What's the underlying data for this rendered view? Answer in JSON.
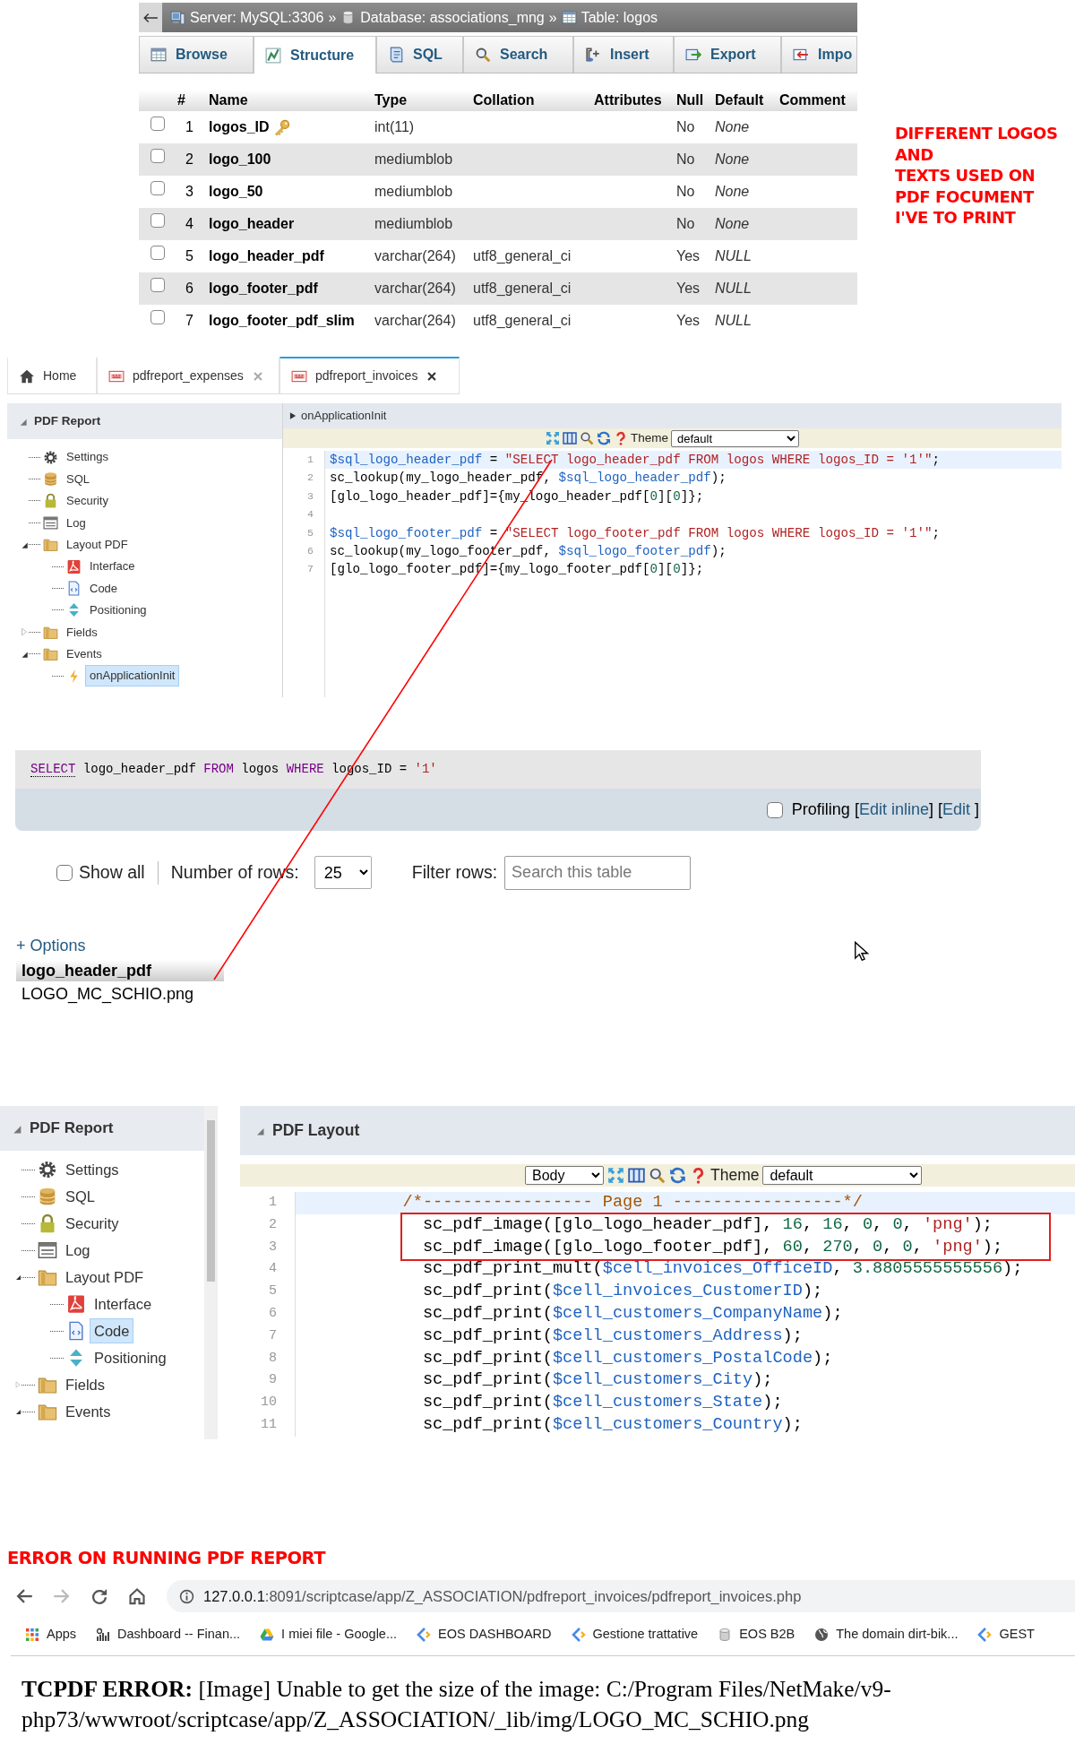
{
  "phpmyadmin": {
    "breadcrumb": [
      {
        "label": "Server: MySQL:3306",
        "kind": "server"
      },
      {
        "label": "Database: associations_mng",
        "kind": "database"
      },
      {
        "label": "Table: logos",
        "kind": "table"
      }
    ],
    "separator": "»",
    "tabs": [
      {
        "label": "Browse",
        "kind": "browse",
        "selected": false
      },
      {
        "label": "Structure",
        "kind": "structure",
        "selected": true
      },
      {
        "label": "SQL",
        "kind": "sql",
        "selected": false
      },
      {
        "label": "Search",
        "kind": "search",
        "selected": false
      },
      {
        "label": "Insert",
        "kind": "insert",
        "selected": false
      },
      {
        "label": "Export",
        "kind": "export",
        "selected": false
      },
      {
        "label": "Impo",
        "kind": "import",
        "selected": false
      }
    ],
    "columns": [
      "#",
      "Name",
      "Type",
      "Collation",
      "Attributes",
      "Null",
      "Default",
      "Comment"
    ],
    "rows": [
      {
        "checked": false,
        "number": "1",
        "name": "logos_ID",
        "primary_key": true,
        "type": "int(11)",
        "null": "No",
        "default": "None"
      },
      {
        "checked": false,
        "number": "2",
        "name": "logo_100",
        "primary_key": false,
        "type": "mediumblob",
        "null": "No",
        "default": "None"
      },
      {
        "checked": false,
        "number": "3",
        "name": "logo_50",
        "primary_key": false,
        "type": "mediumblob",
        "null": "No",
        "default": "None"
      },
      {
        "checked": false,
        "number": "4",
        "name": "logo_header",
        "primary_key": false,
        "type": "mediumblob",
        "null": "No",
        "default": "None"
      },
      {
        "checked": false,
        "number": "5",
        "name": "logo_header_pdf",
        "primary_key": false,
        "type": "varchar(264)",
        "collation": "utf8_general_ci",
        "null": "Yes",
        "default": "NULL"
      },
      {
        "checked": false,
        "number": "6",
        "name": "logo_footer_pdf",
        "primary_key": false,
        "type": "varchar(264)",
        "collation": "utf8_general_ci",
        "null": "Yes",
        "default": "NULL"
      },
      {
        "checked": false,
        "number": "7",
        "name": "logo_footer_pdf_slim",
        "primary_key": false,
        "type": "varchar(264)",
        "collation": "utf8_general_ci",
        "null": "Yes",
        "default": "NULL"
      }
    ]
  },
  "annotation_note": {
    "lines": [
      "DIFFERENT LOGOS",
      "AND",
      "TEXTS USED ON",
      "PDF FOCUMENT",
      "I'VE TO PRINT"
    ]
  },
  "scriptcase_events": {
    "tabs": [
      {
        "label": "Home",
        "kind": "home",
        "closable": false,
        "selected": false
      },
      {
        "label": "pdfreport_expenses",
        "kind": "pdf",
        "closable": true,
        "selected": false
      },
      {
        "label": "pdfreport_invoices",
        "kind": "pdf",
        "closable": true,
        "selected": true
      }
    ],
    "sidebar_title": "PDF Report",
    "tree": [
      {
        "label": "Settings",
        "kind": "settings",
        "selected": false
      },
      {
        "label": "SQL",
        "kind": "sql",
        "selected": false
      },
      {
        "label": "Security",
        "kind": "security",
        "selected": false
      },
      {
        "label": "Log",
        "kind": "log",
        "selected": false
      },
      {
        "label": "Layout PDF",
        "kind": "folder",
        "selected": false,
        "expanded": true,
        "children": [
          {
            "label": "Interface",
            "kind": "interface",
            "selected": false
          },
          {
            "label": "Code",
            "kind": "code",
            "selected": false
          },
          {
            "label": "Positioning",
            "kind": "positioning",
            "selected": false
          }
        ]
      },
      {
        "label": "Fields",
        "kind": "folder",
        "selected": false,
        "expanded": false
      },
      {
        "label": "Events",
        "kind": "folder",
        "selected": false,
        "expanded": true,
        "children": [
          {
            "label": "onApplicationInit",
            "kind": "event",
            "selected": true
          }
        ]
      }
    ],
    "event_title": "onApplicationInit",
    "theme_label": "Theme",
    "theme_value": "default",
    "code": [
      {
        "number": "1",
        "current": true,
        "tokens": [
          {
            "text": "$sql_logo_header_pdf",
            "kind": "var"
          },
          {
            "text": " = ",
            "kind": "plain"
          },
          {
            "text": "\"SELECT logo_header_pdf FROM logos WHERE logos_ID = '1'\"",
            "kind": "string"
          },
          {
            "text": ";",
            "kind": "plain"
          }
        ]
      },
      {
        "number": "2",
        "current": false,
        "tokens": [
          {
            "text": "sc_lookup(my_logo_header_pdf, ",
            "kind": "plain"
          },
          {
            "text": "$sql_logo_header_pdf",
            "kind": "var"
          },
          {
            "text": ");",
            "kind": "plain"
          }
        ]
      },
      {
        "number": "3",
        "current": false,
        "tokens": [
          {
            "text": "[glo_logo_header_pdf]={my_logo_header_pdf[",
            "kind": "plain"
          },
          {
            "text": "0",
            "kind": "number"
          },
          {
            "text": "][",
            "kind": "plain"
          },
          {
            "text": "0",
            "kind": "number"
          },
          {
            "text": "]};",
            "kind": "plain"
          }
        ]
      },
      {
        "number": "4",
        "current": false
      },
      {
        "number": "5",
        "current": false,
        "tokens": [
          {
            "text": "$sql_logo_footer_pdf",
            "kind": "var"
          },
          {
            "text": " = ",
            "kind": "plain"
          },
          {
            "text": "\"SELECT logo_footer_pdf FROM logos WHERE logos_ID = '1'\"",
            "kind": "string"
          },
          {
            "text": ";",
            "kind": "plain"
          }
        ]
      },
      {
        "number": "6",
        "current": false,
        "tokens": [
          {
            "text": "sc_lookup(my_logo_footer_pdf, ",
            "kind": "plain"
          },
          {
            "text": "$sql_logo_footer_pdf",
            "kind": "var"
          },
          {
            "text": ");",
            "kind": "plain"
          }
        ]
      },
      {
        "number": "7",
        "current": false,
        "tokens": [
          {
            "text": "[glo_logo_footer_pdf]={my_logo_footer_pdf[",
            "kind": "plain"
          },
          {
            "text": "0",
            "kind": "number"
          },
          {
            "text": "][",
            "kind": "plain"
          },
          {
            "text": "0",
            "kind": "number"
          },
          {
            "text": "]};",
            "kind": "plain"
          }
        ]
      }
    ]
  },
  "sql_query": {
    "tokens": [
      {
        "text": "SELECT",
        "kind": "doc_keyword"
      },
      {
        "text": " logo_header_pdf ",
        "kind": "plain"
      },
      {
        "text": "FROM",
        "kind": "keyword"
      },
      {
        "text": " logos ",
        "kind": "plain"
      },
      {
        "text": "WHERE",
        "kind": "keyword"
      },
      {
        "text": " logos_ID = ",
        "kind": "plain"
      },
      {
        "text": "'1'",
        "kind": "string"
      }
    ],
    "profiling": {
      "checked": false,
      "label": "Profiling",
      "links": [
        {
          "text": "[",
          "kind": "plain"
        },
        {
          "text": "Edit inline",
          "kind": "link"
        },
        {
          "text": "] [",
          "kind": "plain"
        },
        {
          "text": "Edit",
          "kind": "link"
        },
        {
          "text": " ]",
          "kind": "plain"
        }
      ]
    }
  },
  "filter": {
    "show_all_label": "Show all",
    "show_all_checked": false,
    "rows_label": "Number of rows:",
    "rows_value": "25",
    "filter_label": "Filter rows:",
    "filter_placeholder": "Search this table"
  },
  "result": {
    "options_link": "+ Options",
    "column": "logo_header_pdf",
    "value": "LOGO_MC_SCHIO.png"
  },
  "scriptcase_layout": {
    "sidebar_title": "PDF Report",
    "tree": [
      {
        "label": "Settings",
        "kind": "settings",
        "selected": false
      },
      {
        "label": "SQL",
        "kind": "sql",
        "selected": false
      },
      {
        "label": "Security",
        "kind": "security",
        "selected": false
      },
      {
        "label": "Log",
        "kind": "log",
        "selected": false
      },
      {
        "label": "Layout PDF",
        "kind": "folder",
        "selected": false,
        "expanded": true,
        "children": [
          {
            "label": "Interface",
            "kind": "interface",
            "selected": false
          },
          {
            "label": "Code",
            "kind": "code",
            "selected": true
          },
          {
            "label": "Positioning",
            "kind": "positioning",
            "selected": false
          }
        ]
      },
      {
        "label": "Fields",
        "kind": "folder",
        "selected": false,
        "expanded": false
      },
      {
        "label": "Events",
        "kind": "folder",
        "selected": false,
        "expanded": true
      }
    ],
    "panel_title": "PDF Layout",
    "section_value": "Body",
    "theme_label": "Theme",
    "theme_value": "default",
    "code": [
      {
        "number": "1",
        "current": true,
        "highlighted": false,
        "tokens": [
          {
            "text": "          /*----------------- Page 1 -----------------*/",
            "kind": "comment"
          }
        ]
      },
      {
        "number": "2",
        "current": false,
        "highlighted": true,
        "tokens": [
          {
            "text": "            sc_pdf_image([glo_logo_header_pdf], ",
            "kind": "plain"
          },
          {
            "text": "16",
            "kind": "number"
          },
          {
            "text": ", ",
            "kind": "plain"
          },
          {
            "text": "16",
            "kind": "number"
          },
          {
            "text": ", ",
            "kind": "plain"
          },
          {
            "text": "0",
            "kind": "number"
          },
          {
            "text": ", ",
            "kind": "plain"
          },
          {
            "text": "0",
            "kind": "number"
          },
          {
            "text": ", ",
            "kind": "plain"
          },
          {
            "text": "'png'",
            "kind": "string"
          },
          {
            "text": ");",
            "kind": "plain"
          }
        ]
      },
      {
        "number": "3",
        "current": false,
        "highlighted": true,
        "tokens": [
          {
            "text": "            sc_pdf_image([glo_logo_footer_pdf], ",
            "kind": "plain"
          },
          {
            "text": "60",
            "kind": "number"
          },
          {
            "text": ", ",
            "kind": "plain"
          },
          {
            "text": "270",
            "kind": "number"
          },
          {
            "text": ", ",
            "kind": "plain"
          },
          {
            "text": "0",
            "kind": "number"
          },
          {
            "text": ", ",
            "kind": "plain"
          },
          {
            "text": "0",
            "kind": "number"
          },
          {
            "text": ", ",
            "kind": "plain"
          },
          {
            "text": "'png'",
            "kind": "string"
          },
          {
            "text": ");",
            "kind": "plain"
          }
        ]
      },
      {
        "number": "4",
        "current": false,
        "highlighted": false,
        "tokens": [
          {
            "text": "            sc_pdf_print_mult(",
            "kind": "plain"
          },
          {
            "text": "$cell_invoices_OfficeID",
            "kind": "var"
          },
          {
            "text": ", ",
            "kind": "plain"
          },
          {
            "text": "3.8805555555556",
            "kind": "number"
          },
          {
            "text": ");",
            "kind": "plain"
          }
        ]
      },
      {
        "number": "5",
        "current": false,
        "highlighted": false,
        "tokens": [
          {
            "text": "            sc_pdf_print(",
            "kind": "plain"
          },
          {
            "text": "$cell_invoices_CustomerID",
            "kind": "var"
          },
          {
            "text": ");",
            "kind": "plain"
          }
        ]
      },
      {
        "number": "6",
        "current": false,
        "highlighted": false,
        "tokens": [
          {
            "text": "            sc_pdf_print(",
            "kind": "plain"
          },
          {
            "text": "$cell_customers_CompanyName",
            "kind": "var"
          },
          {
            "text": ");",
            "kind": "plain"
          }
        ]
      },
      {
        "number": "7",
        "current": false,
        "highlighted": false,
        "tokens": [
          {
            "text": "            sc_pdf_print(",
            "kind": "plain"
          },
          {
            "text": "$cell_customers_Address",
            "kind": "var"
          },
          {
            "text": ");",
            "kind": "plain"
          }
        ]
      },
      {
        "number": "8",
        "current": false,
        "highlighted": false,
        "tokens": [
          {
            "text": "            sc_pdf_print(",
            "kind": "plain"
          },
          {
            "text": "$cell_customers_PostalCode",
            "kind": "var"
          },
          {
            "text": ");",
            "kind": "plain"
          }
        ]
      },
      {
        "number": "9",
        "current": false,
        "highlighted": false,
        "tokens": [
          {
            "text": "            sc_pdf_print(",
            "kind": "plain"
          },
          {
            "text": "$cell_customers_City",
            "kind": "var"
          },
          {
            "text": ");",
            "kind": "plain"
          }
        ]
      },
      {
        "number": "10",
        "current": false,
        "highlighted": false,
        "tokens": [
          {
            "text": "            sc_pdf_print(",
            "kind": "plain"
          },
          {
            "text": "$cell_customers_State",
            "kind": "var"
          },
          {
            "text": ");",
            "kind": "plain"
          }
        ]
      },
      {
        "number": "11",
        "current": false,
        "highlighted": false,
        "tokens": [
          {
            "text": "            sc_pdf_print(",
            "kind": "plain"
          },
          {
            "text": "$cell_customers_Country",
            "kind": "var"
          },
          {
            "text": ");",
            "kind": "plain"
          }
        ]
      }
    ]
  },
  "error_caption": "ERROR ON RUNNING PDF REPORT",
  "browser": {
    "url_host": "127.0.0.1",
    "url_path": ":8091/scriptcase/app/Z_ASSOCIATION/pdfreport_invoices/pdfreport_invoices.php",
    "bookmarks": [
      {
        "label": "Apps",
        "kind": "apps"
      },
      {
        "label": "Dashboard -- Finan...",
        "kind": "dashboard"
      },
      {
        "label": "I miei file - Google...",
        "kind": "drive"
      },
      {
        "label": "EOS DASHBOARD",
        "kind": "scriptcase"
      },
      {
        "label": "Gestione trattative",
        "kind": "scriptcase"
      },
      {
        "label": "EOS B2B",
        "kind": "server"
      },
      {
        "label": "The domain dirt-bik...",
        "kind": "globe"
      },
      {
        "label": "GEST",
        "kind": "scriptcase"
      }
    ]
  },
  "error_message": "**TCPDF ERROR:** [Image] Unable to get the size of the image: C:/Program Files/NetMake/v9-php73/wwwroot/scriptcase/app/Z_ASSOCIATION/_lib/img/LOGO_MC_SCHIO.png"
}
